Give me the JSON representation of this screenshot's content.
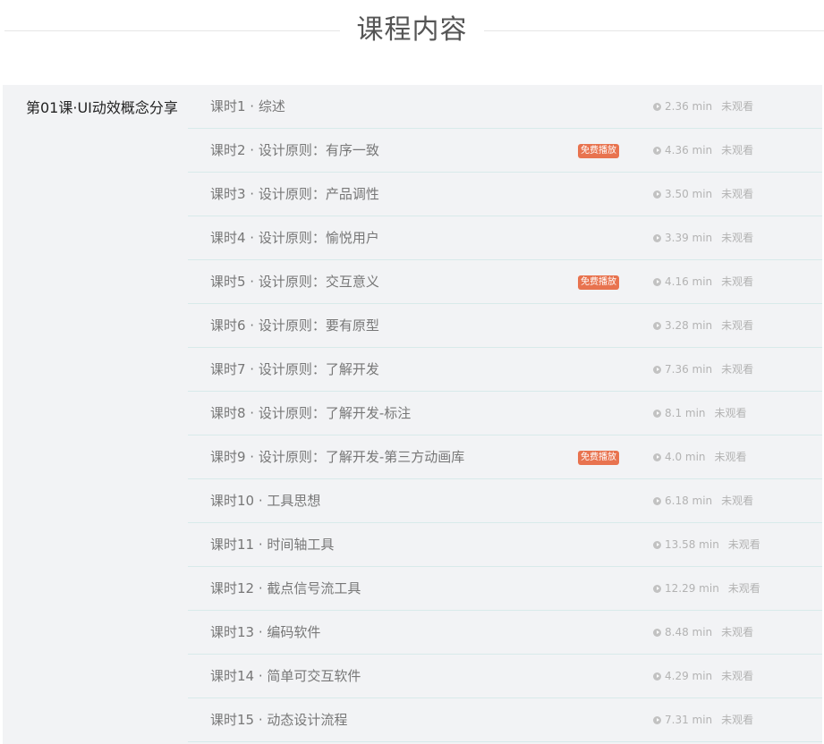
{
  "header": {
    "title": "课程内容"
  },
  "chapter": {
    "title": "第01课·UI动效概念分享"
  },
  "lessons": [
    {
      "name": "课时1 · 综述",
      "duration": "2.36 min",
      "status": "未观看",
      "badge": ""
    },
    {
      "name": "课时2 · 设计原则：有序一致",
      "duration": "4.36 min",
      "status": "未观看",
      "badge": "免费播放"
    },
    {
      "name": "课时3 · 设计原则：产品调性",
      "duration": "3.50 min",
      "status": "未观看",
      "badge": ""
    },
    {
      "name": "课时4 · 设计原则：愉悦用户",
      "duration": "3.39 min",
      "status": "未观看",
      "badge": ""
    },
    {
      "name": "课时5 · 设计原则：交互意义",
      "duration": "4.16 min",
      "status": "未观看",
      "badge": "免费播放"
    },
    {
      "name": "课时6 · 设计原则：要有原型",
      "duration": "3.28 min",
      "status": "未观看",
      "badge": ""
    },
    {
      "name": "课时7 · 设计原则：了解开发",
      "duration": "7.36 min",
      "status": "未观看",
      "badge": ""
    },
    {
      "name": "课时8 · 设计原则：了解开发-标注",
      "duration": "8.1 min",
      "status": "未观看",
      "badge": ""
    },
    {
      "name": "课时9 · 设计原则：了解开发-第三方动画库",
      "duration": "4.0 min",
      "status": "未观看",
      "badge": "免费播放"
    },
    {
      "name": "课时10 · 工具思想",
      "duration": "6.18 min",
      "status": "未观看",
      "badge": ""
    },
    {
      "name": "课时11 · 时间轴工具",
      "duration": "13.58 min",
      "status": "未观看",
      "badge": ""
    },
    {
      "name": "课时12 · 截点信号流工具",
      "duration": "12.29 min",
      "status": "未观看",
      "badge": ""
    },
    {
      "name": "课时13 · 编码软件",
      "duration": "8.48 min",
      "status": "未观看",
      "badge": ""
    },
    {
      "name": "课时14 · 简单可交互软件",
      "duration": "4.29 min",
      "status": "未观看",
      "badge": ""
    },
    {
      "name": "课时15 · 动态设计流程",
      "duration": "7.31 min",
      "status": "未观看",
      "badge": ""
    }
  ]
}
